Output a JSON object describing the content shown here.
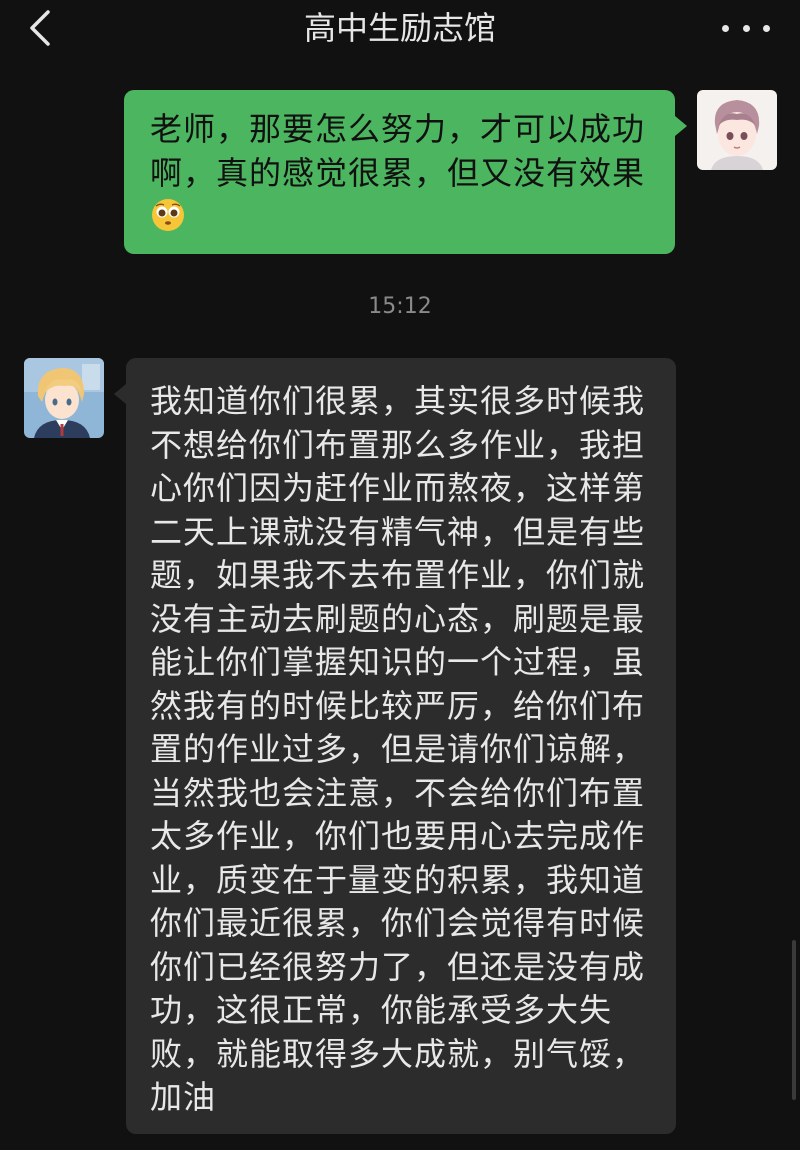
{
  "header": {
    "title": "高中生励志馆",
    "back_icon": "chevron-left-icon",
    "more_icon": "more-dots-icon"
  },
  "messages": [
    {
      "sender": "me",
      "text": "老师，那要怎么努力，才可以成功啊，真的感觉很累，但又没有效果",
      "emoji": "pleading-face-emoji"
    },
    {
      "sender": "teacher",
      "text": "我知道你们很累，其实很多时候我不想给你们布置那么多作业，我担心你们因为赶作业而熬夜，这样第二天上课就没有精气神，但是有些题，如果我不去布置作业，你们就没有主动去刷题的心态，刷题是最能让你们掌握知识的一个过程，虽然我有的时候比较严厉，给你们布置的作业过多，但是请你们谅解，当然我也会注意，不会给你们布置太多作业，你们也要用心去完成作业，质变在于量变的积累，我知道你们最近很累，你们会觉得有时候你们已经很努力了，但还是没有成功，这很正常，你能承受多大失败，就能取得多大成就，别气馁，加油"
    }
  ],
  "timestamp": "15:12",
  "colors": {
    "background": "#111111",
    "my_bubble": "#4cb55f",
    "their_bubble": "#2c2c2c",
    "timestamp": "#8a8a8a"
  }
}
